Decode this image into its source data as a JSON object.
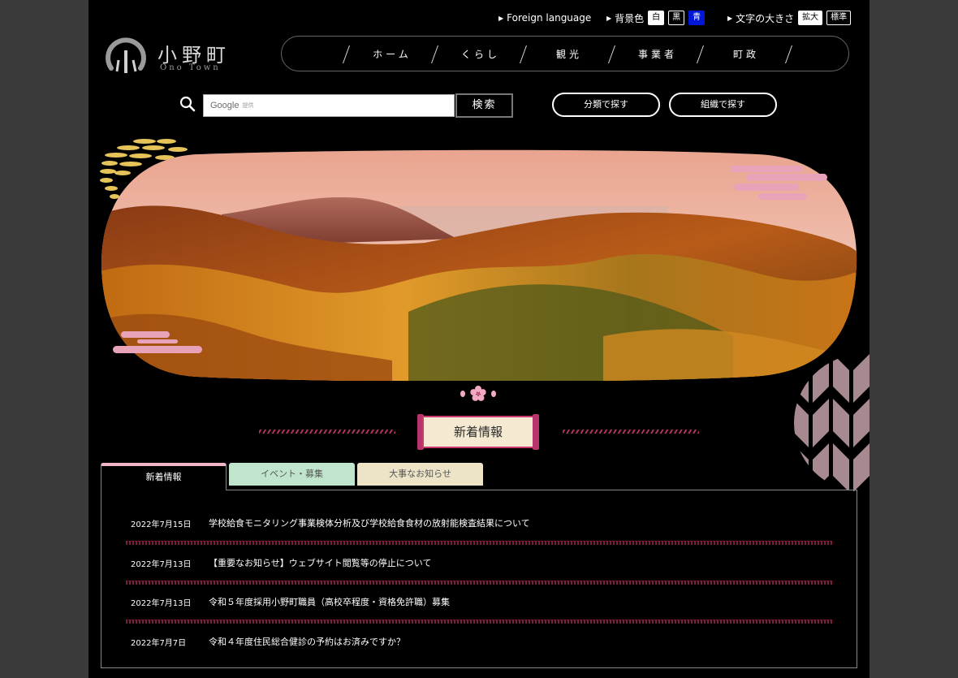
{
  "utility": {
    "foreign_language": "Foreign language",
    "bg_color_label": "背景色",
    "bg_white": "白",
    "bg_black": "黒",
    "bg_blue": "青",
    "font_size_label": "文字の大きさ",
    "font_large": "拡大",
    "font_standard": "標準"
  },
  "logo": {
    "name_ja": "小野町",
    "name_en": "Ono Town"
  },
  "nav": {
    "items": [
      {
        "label": "ホーム"
      },
      {
        "label": "くらし"
      },
      {
        "label": "観光"
      },
      {
        "label": "事業者"
      },
      {
        "label": "町政"
      }
    ]
  },
  "search": {
    "google_text": "Google",
    "provided_text": "提供",
    "button_label": "検索",
    "category_button": "分類で探す",
    "organization_button": "組織で探す"
  },
  "section": {
    "title": "新着情報"
  },
  "tabs": [
    {
      "label": "新着情報"
    },
    {
      "label": "イベント・募集"
    },
    {
      "label": "大事なお知らせ"
    }
  ],
  "news": [
    {
      "date": "2022年7月15日",
      "title": "学校給食モニタリング事業検体分析及び学校給食食材の放射能検査結果について"
    },
    {
      "date": "2022年7月13日",
      "title": "【重要なお知らせ】ウェブサイト閲覧等の停止について"
    },
    {
      "date": "2022年7月13日",
      "title": "令和５年度採用小野町職員（高校卒程度・資格免許職）募集"
    },
    {
      "date": "2022年7月7日",
      "title": "令和４年度住民総合健診の予約はお済みですか？"
    }
  ],
  "colors": {
    "accent_pink": "#c93b6e",
    "tab_event_bg": "#bfe6cc",
    "tab_notice_bg": "#ede3c6",
    "bg_blue_chip": "#0018d6"
  }
}
